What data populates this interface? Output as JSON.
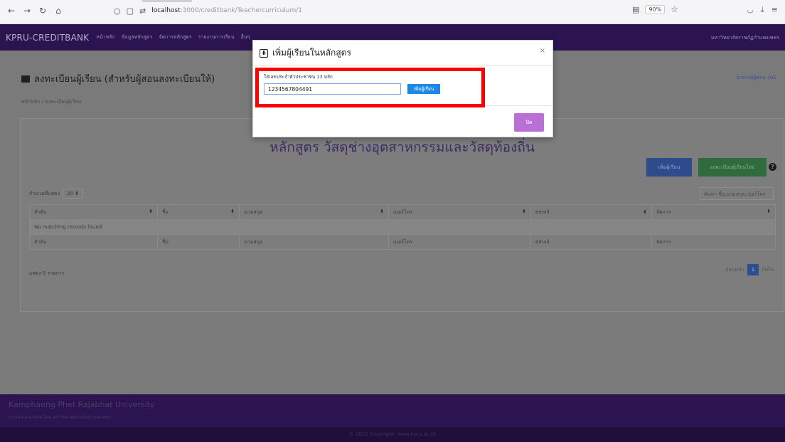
{
  "browser": {
    "url_host": "localhost",
    "url_path": ":3000/creditbank/Teachercurriculum/1",
    "zoom": "90%"
  },
  "navbar": {
    "brand": "KPRU-CREDITBANK",
    "items": [
      "หน้าหลัก",
      "ข้อมูลหลักสูตร",
      "จัดการหลักสูตร",
      "รายงานการเรียน",
      "อื่นๆ"
    ],
    "right_text": "มหาวิทยาลัยราชภัฏกำแพงเพชร"
  },
  "page": {
    "heading": "ลงทะเบียนผู้เรียน (สำหรับผู้สอนลงทะเบียนให้)",
    "teacher_link": "อาจารย์ผู้สอน รุ่น1",
    "breadcrumb": "หน้าหลัก / ลงทะเบียนผู้เรียน",
    "course_title": "หลักสูตร วัสดุช่างอุตสาหกรรมและวัสดุท้องถิ่น",
    "btn_add_student": "เพิ่มผู้เรียน",
    "btn_add_new_student": "ลงทะเบียนผู้เรียนใหม่",
    "show_label": "จำนวนที่แสดง",
    "page_size": "20",
    "search_placeholder": "ค้นหา ชื่อ,นามสกุล,เบอร์โทร",
    "columns": [
      "ลำดับ",
      "ชื่อ",
      "นามสกุล",
      "เบอร์โทร",
      "email",
      "จัดการ"
    ],
    "no_records": "No matching records found",
    "summary": "แสดง 0 รายการ",
    "pager_prev": "ก่อนหน้า",
    "pager_current": "1",
    "pager_next": "ถัดไป"
  },
  "footer": {
    "university": "Kamphaeng Phet Rajabhat University",
    "subtitle": "ระบบคลังหน่วยกิต โดย มหาวิทยาลัยราชภัฏกำแพงเพชร",
    "copyright": "© 2022 Copyright: www.kpru.ac.th"
  },
  "modal": {
    "title": "เพิ่มผู้เรียนในหลักสูตร",
    "input_label": "ใส่เลขประจำตัวประชาชน 13 หลัก",
    "input_value": "1234567804491",
    "add_button": "เพิ่มผู้เรียน",
    "close_button": "ปิด",
    "close_icon": "×"
  },
  "colors": {
    "navbar_bg": "#2b1450",
    "primary": "#1e88e5",
    "close_btn": "#b96fd6",
    "highlight": "#ff0000"
  }
}
